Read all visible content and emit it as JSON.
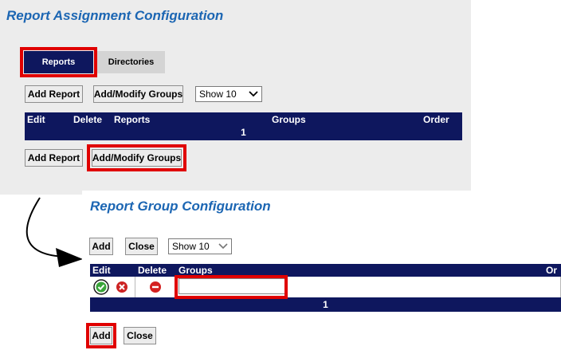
{
  "report_assignment": {
    "title": "Report Assignment Configuration",
    "tabs": [
      {
        "label": "Reports",
        "active": true
      },
      {
        "label": "Directories",
        "active": false
      }
    ],
    "toolbar": {
      "add_report_label": "Add Report",
      "add_modify_groups_label": "Add/Modify Groups",
      "show_select_value": "Show 10"
    },
    "table": {
      "columns": [
        "Edit",
        "Delete",
        "Reports",
        "Groups",
        "Order"
      ],
      "page": "1"
    },
    "bottom_toolbar": {
      "add_report_label": "Add Report",
      "add_modify_groups_label": "Add/Modify Groups"
    }
  },
  "report_group": {
    "title": "Report Group Configuration",
    "toolbar": {
      "add_label": "Add",
      "close_label": "Close",
      "show_select_value": "Show 10"
    },
    "table": {
      "columns": [
        "Edit",
        "Delete",
        "Groups",
        "Or"
      ],
      "row": {
        "group_value": ""
      },
      "page": "1"
    },
    "bottom_toolbar": {
      "add_label": "Add",
      "close_label": "Close"
    }
  },
  "colors": {
    "title": "#1c66b3",
    "table_header": "#0e175e",
    "highlight": "#e00000",
    "panel_bg": "#ececec"
  }
}
